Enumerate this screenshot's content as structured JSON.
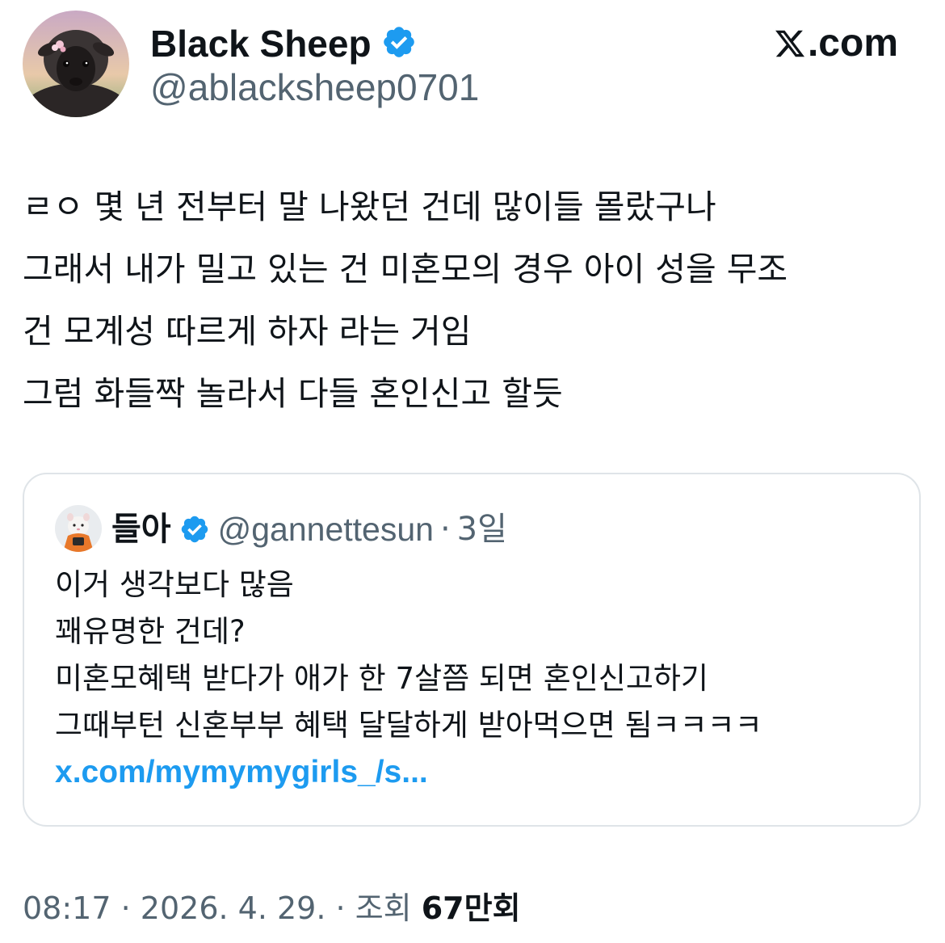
{
  "author": {
    "display_name": "Black Sheep",
    "handle": "@ablacksheep0701",
    "avatar_icon": "black-sheep-avatar",
    "verified_icon": "verified-badge-icon",
    "verified_color": "#1d9bf0"
  },
  "site": {
    "label": ".com",
    "logo_icon": "x-logo-icon"
  },
  "tweet": {
    "lines": [
      "ㄹㅇ 몇 년 전부터 말 나왔던 건데 많이들 몰랐구나",
      "그래서 내가 밀고 있는 건 미혼모의 경우 아이 성을 무조",
      "건 모계성 따르게 하자 라는 거임",
      "그럼 화들짝 놀라서 다들 혼인신고 할듯"
    ]
  },
  "quote": {
    "display_name": "들아",
    "handle": "@gannettesun",
    "separator": "·",
    "time": "3일",
    "avatar_icon": "hamster-avatar",
    "lines": [
      "이거 생각보다 많음",
      "꽤유명한 건데?",
      "미혼모혜택 받다가 애가 한 7살쯤 되면 혼인신고하기",
      "그때부턴 신혼부부 혜택 달달하게 받아먹으면 됨ㅋㅋㅋㅋ"
    ],
    "link": "x.com/mymymygirls_/s..."
  },
  "meta": {
    "time": "08:17",
    "sep1": "·",
    "date": "2026. 4. 29.",
    "sep2": "·",
    "views_label": "조회",
    "views_number": "67",
    "views_unit": "만회"
  },
  "colors": {
    "text_primary": "#0f1419",
    "text_secondary": "#536471",
    "link": "#1d9bf0",
    "border": "#dfe4e8"
  }
}
